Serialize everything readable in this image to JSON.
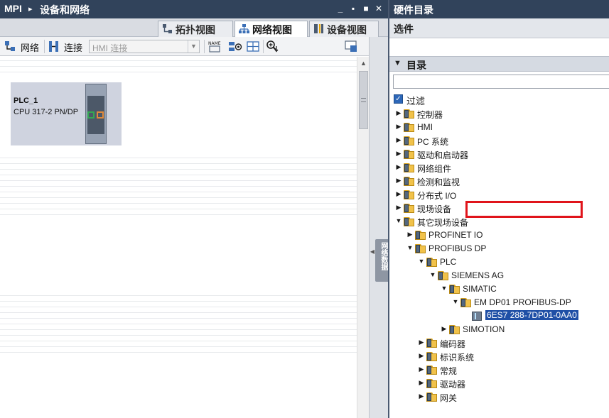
{
  "left_pane": {
    "breadcrumb": {
      "root": "MPI",
      "separator": "▸",
      "current": "设备和网络"
    },
    "window_buttons": {
      "minimize": "_",
      "float": "▪",
      "maximize": "■",
      "close": "✕"
    },
    "view_tabs": [
      {
        "label": "拓扑视图",
        "icon": "topology-icon",
        "active": false
      },
      {
        "label": "网络视图",
        "icon": "network-icon",
        "active": true
      },
      {
        "label": "设备视图",
        "icon": "device-icon",
        "active": false
      }
    ],
    "toolbar": {
      "network_label": "网络",
      "connection_label": "连接",
      "connection_type_value": "HMI 连接",
      "icons": [
        "network-mode-icon",
        "connection-mode-icon",
        "name-icon",
        "address-icon",
        "table-icon",
        "zoom-icon",
        "overview-icon"
      ]
    },
    "canvas": {
      "device": {
        "name": "PLC_1",
        "type": "CPU 317-2 PN/DP",
        "colors": {
          "profinet_port": "#34a853",
          "dp_port": "#e08a3c"
        }
      }
    },
    "side_tab_label": "网络数据"
  },
  "right_pane": {
    "title": "硬件目录",
    "options_label": "选件",
    "catalog_label": "目录",
    "search": {
      "value": "",
      "placeholder": ""
    },
    "filter": {
      "label": "过滤",
      "checked": true
    },
    "tree": [
      {
        "label": "控制器",
        "expanded": false,
        "level": 0
      },
      {
        "label": "HMI",
        "expanded": false,
        "level": 0
      },
      {
        "label": "PC 系统",
        "expanded": false,
        "level": 0
      },
      {
        "label": "驱动和启动器",
        "expanded": false,
        "level": 0
      },
      {
        "label": "网络组件",
        "expanded": false,
        "level": 0
      },
      {
        "label": "检测和监视",
        "expanded": false,
        "level": 0
      },
      {
        "label": "分布式 I/O",
        "expanded": false,
        "level": 0
      },
      {
        "label": "现场设备",
        "expanded": false,
        "level": 0
      },
      {
        "label": "其它现场设备",
        "expanded": true,
        "level": 0
      },
      {
        "label": "PROFINET IO",
        "expanded": false,
        "level": 1
      },
      {
        "label": "PROFIBUS DP",
        "expanded": true,
        "level": 1
      },
      {
        "label": "PLC",
        "expanded": true,
        "level": 2
      },
      {
        "label": "SIEMENS AG",
        "expanded": true,
        "level": 3
      },
      {
        "label": "SIMATIC",
        "expanded": true,
        "level": 4
      },
      {
        "label": "EM DP01 PROFIBUS-DP",
        "expanded": true,
        "level": 5
      },
      {
        "label": "6ES7 288-7DP01-0AA0",
        "level": 6,
        "selected": true,
        "leaf": true
      },
      {
        "label": "SIMOTION",
        "expanded": false,
        "level": 4
      },
      {
        "label": "编码器",
        "expanded": false,
        "level": 2
      },
      {
        "label": "标识系统",
        "expanded": false,
        "level": 2
      },
      {
        "label": "常规",
        "expanded": false,
        "level": 2
      },
      {
        "label": "驱动器",
        "expanded": false,
        "level": 2
      },
      {
        "label": "网关",
        "expanded": false,
        "level": 2
      }
    ],
    "highlight_color": "#e0141b"
  }
}
